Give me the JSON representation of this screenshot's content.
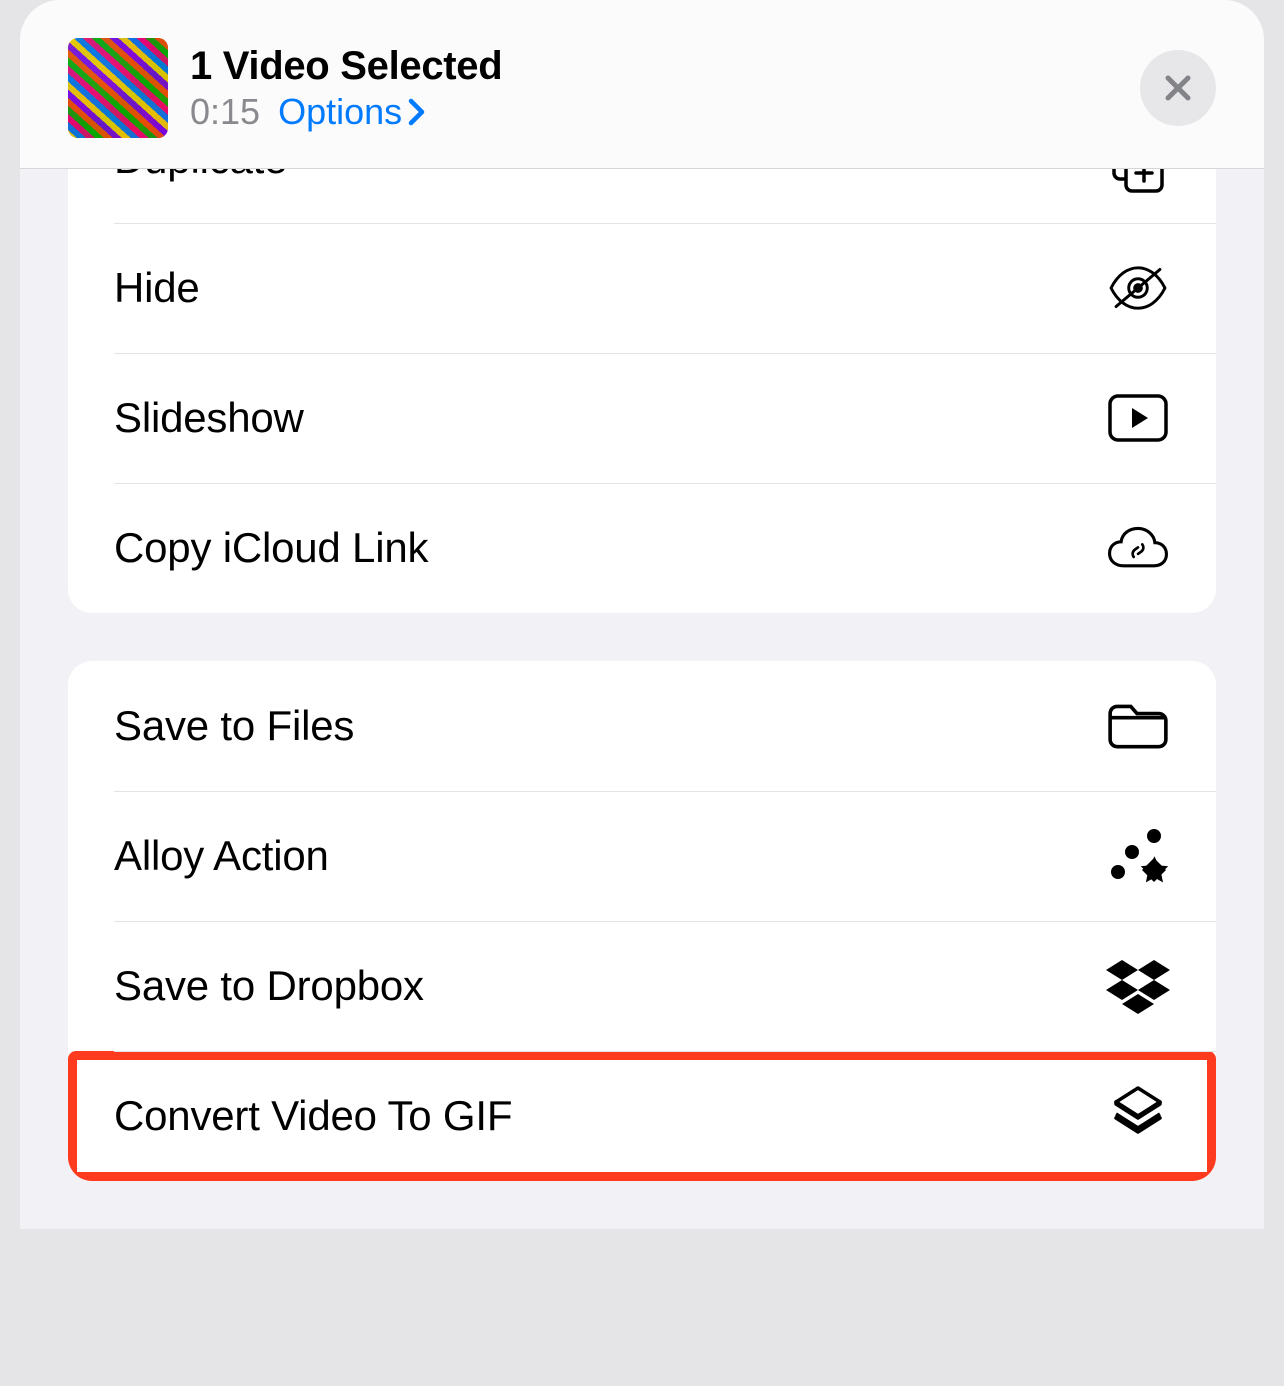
{
  "header": {
    "title": "1 Video Selected",
    "duration": "0:15",
    "options_label": "Options"
  },
  "group1": {
    "duplicate": "Duplicate",
    "hide": "Hide",
    "slideshow": "Slideshow",
    "icloud_link": "Copy iCloud Link"
  },
  "group2": {
    "save_files": "Save to Files",
    "alloy": "Alloy Action",
    "dropbox": "Save to Dropbox",
    "convert_gif": "Convert Video To GIF"
  }
}
